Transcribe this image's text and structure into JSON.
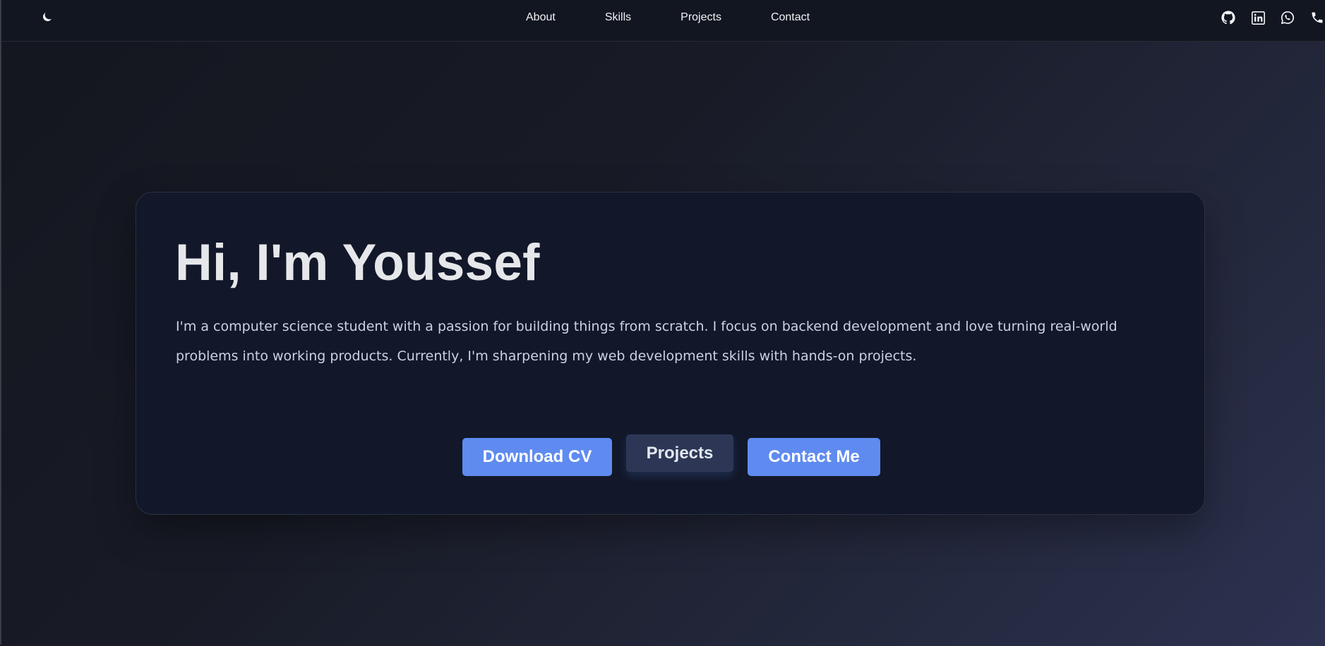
{
  "nav": {
    "theme_icon": "moon-icon",
    "links": [
      {
        "label": "About"
      },
      {
        "label": "Skills"
      },
      {
        "label": "Projects"
      },
      {
        "label": "Contact"
      }
    ],
    "social_icons": [
      "github-icon",
      "linkedin-icon",
      "whatsapp-icon",
      "phone-icon"
    ]
  },
  "hero": {
    "title": "Hi, I'm Youssef",
    "description": "I'm a computer science student with a passion for building things from scratch. I focus on backend development and love turning real-world problems into working products. Currently, I'm sharpening my web development skills with hands-on projects.",
    "buttons": {
      "download_cv": "Download CV",
      "projects": "Projects",
      "contact_me": "Contact Me"
    }
  },
  "colors": {
    "navbar_bg": "#121620",
    "card_bg": "#121829",
    "primary_button": "#5f8bf0",
    "secondary_button": "#2d3755",
    "text_light": "#e6e7ea"
  }
}
